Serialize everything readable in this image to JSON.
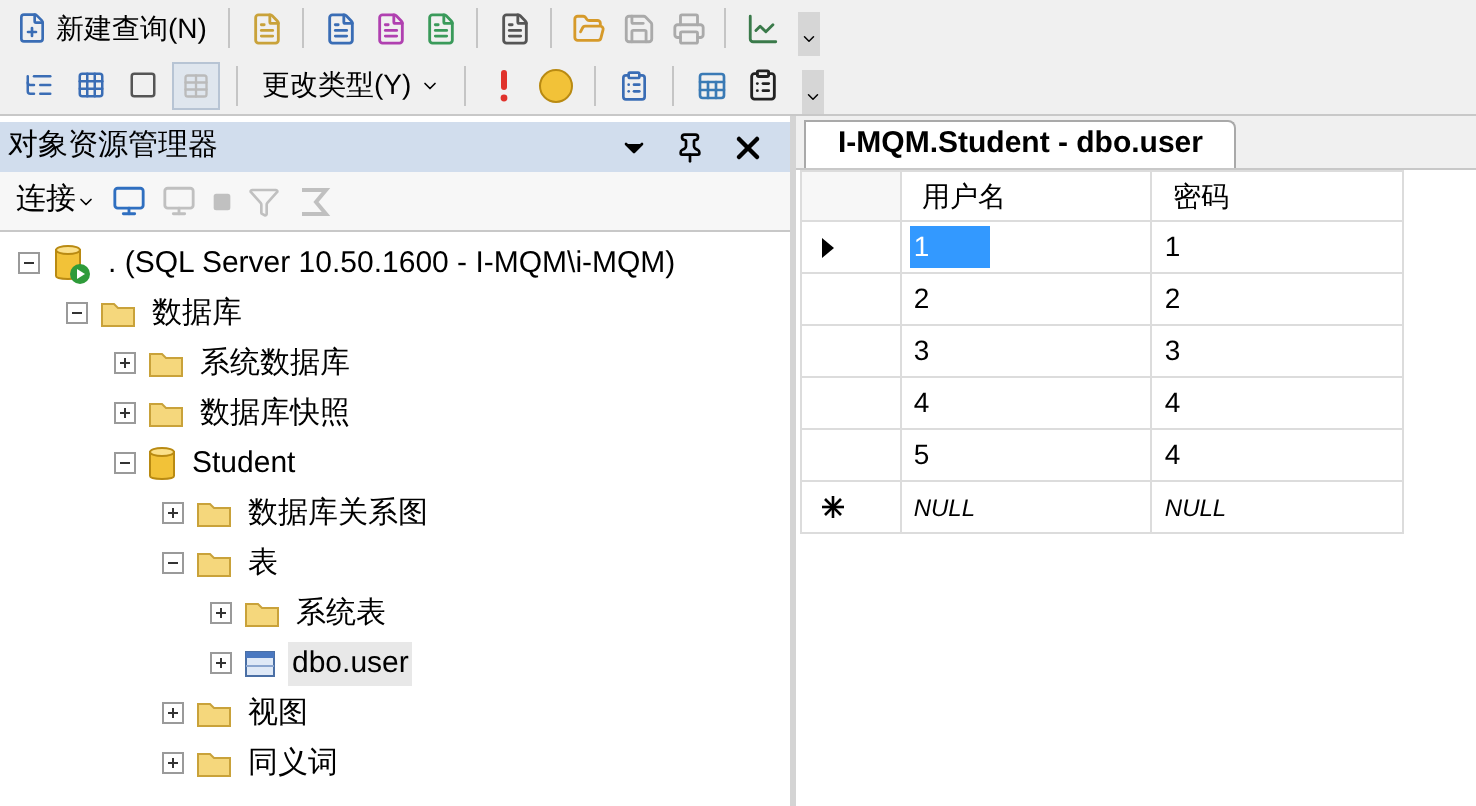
{
  "toolbar_1": {
    "new_query": "新建查询(N)"
  },
  "toolbar_2": {
    "change_type": "更改类型(Y)"
  },
  "object_explorer": {
    "title": "对象资源管理器",
    "connect": "连接",
    "tree": [
      {
        "label": ". (SQL Server 10.50.1600 - I-MQM\\i-MQM)",
        "kind": "server",
        "expanded": true,
        "selected": false,
        "children": [
          {
            "label": "数据库",
            "kind": "folder",
            "expanded": true,
            "selected": false,
            "children": [
              {
                "label": "系统数据库",
                "kind": "folder",
                "expanded": false,
                "selected": false
              },
              {
                "label": "数据库快照",
                "kind": "folder",
                "expanded": false,
                "selected": false
              },
              {
                "label": "Student",
                "kind": "database",
                "expanded": true,
                "selected": false,
                "children": [
                  {
                    "label": "数据库关系图",
                    "kind": "folder",
                    "expanded": false,
                    "selected": false
                  },
                  {
                    "label": "表",
                    "kind": "folder",
                    "expanded": true,
                    "selected": false,
                    "children": [
                      {
                        "label": "系统表",
                        "kind": "folder",
                        "expanded": false,
                        "selected": false
                      },
                      {
                        "label": "dbo.user",
                        "kind": "table",
                        "expanded": false,
                        "selected": true
                      }
                    ]
                  },
                  {
                    "label": "视图",
                    "kind": "folder",
                    "expanded": false,
                    "selected": false
                  },
                  {
                    "label": "同义词",
                    "kind": "folder",
                    "expanded": false,
                    "selected": false
                  }
                ]
              }
            ]
          }
        ]
      }
    ]
  },
  "document": {
    "tab": {
      "label": "I-MQM.Student - dbo.user",
      "selected": true
    },
    "columns": [
      "用户名",
      "密码"
    ],
    "rows": [
      {
        "kind": "current",
        "cells": [
          {
            "text": "1",
            "selected": true
          },
          {
            "text": "1",
            "selected": false
          }
        ]
      },
      {
        "kind": "value",
        "cells": [
          {
            "text": "2",
            "selected": false
          },
          {
            "text": "2",
            "selected": false
          }
        ]
      },
      {
        "kind": "value",
        "cells": [
          {
            "text": "3",
            "selected": false
          },
          {
            "text": "3",
            "selected": false
          }
        ]
      },
      {
        "kind": "value",
        "cells": [
          {
            "text": "4",
            "selected": false
          },
          {
            "text": "4",
            "selected": false
          }
        ]
      },
      {
        "kind": "value",
        "cells": [
          {
            "text": "5",
            "selected": false
          },
          {
            "text": "4",
            "selected": false
          }
        ]
      },
      {
        "kind": "new",
        "cells": [
          {
            "text": "NULL",
            "selected": false
          },
          {
            "text": "NULL",
            "selected": false
          }
        ]
      }
    ]
  }
}
